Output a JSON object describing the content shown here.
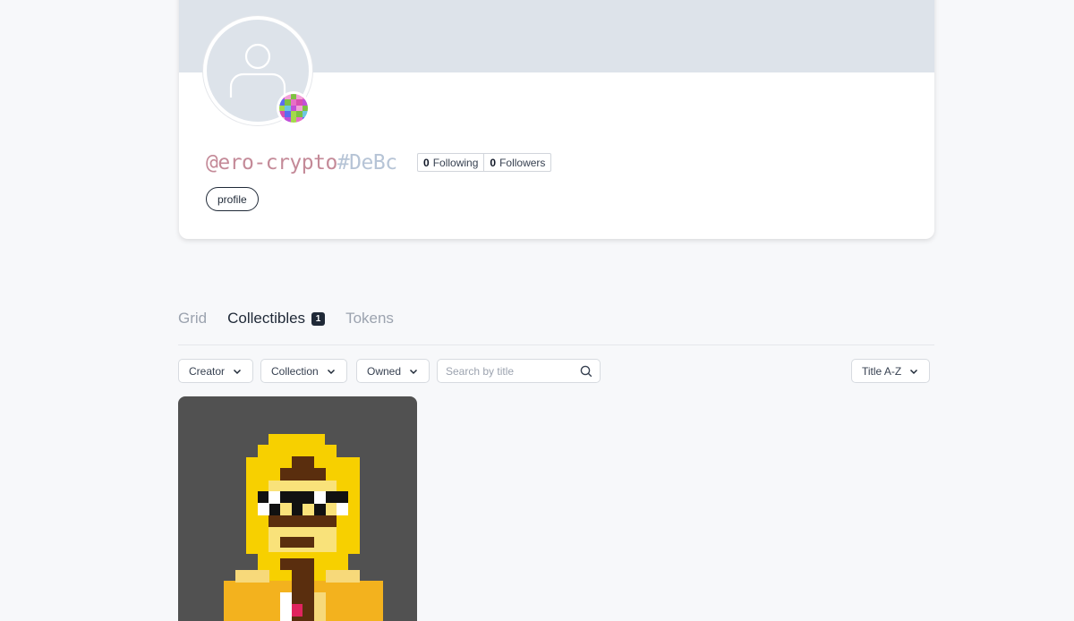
{
  "profile": {
    "handle_name": "@ero-crypto",
    "handle_hash": "#DeBc",
    "following_count": "0",
    "following_label": "Following",
    "followers_count": "0",
    "followers_label": "Followers",
    "tag_label": "profile"
  },
  "tabs": [
    {
      "label": "Grid",
      "active": false
    },
    {
      "label": "Collectibles",
      "active": true,
      "count": "1"
    },
    {
      "label": "Tokens",
      "active": false
    }
  ],
  "filters": {
    "creator": "Creator",
    "collection": "Collection",
    "owned": "Owned",
    "search_placeholder": "Search by title",
    "sort": "Title A-Z"
  },
  "colors": {
    "accent": "#1f2937",
    "cover": "#dde3ea",
    "handle_name": "#c48a98",
    "handle_hash": "#b6c4d6",
    "nft_background": "#515151"
  },
  "icons": {
    "avatar": "user-silhouette-icon",
    "chain": "pixel-chain-badge-icon",
    "search": "search-icon",
    "dropdown": "chevron-down-icon"
  }
}
